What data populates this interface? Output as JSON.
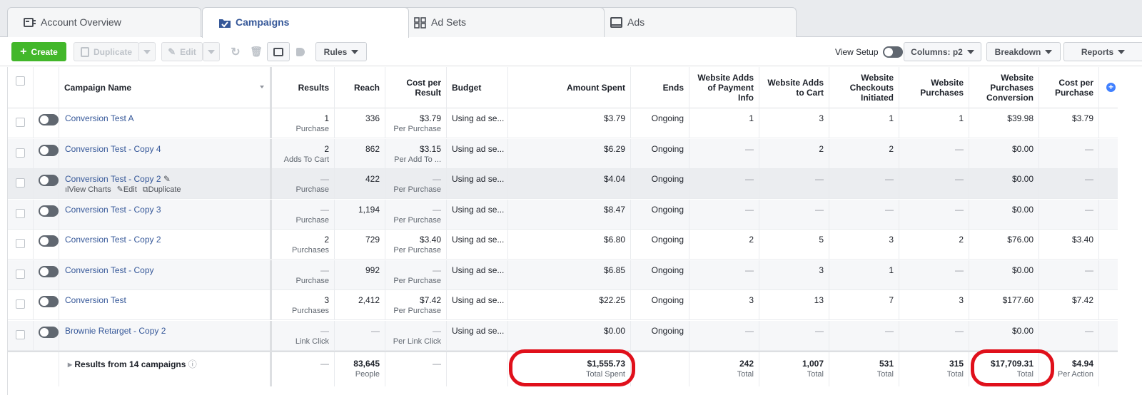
{
  "tabs": [
    {
      "label": "Account Overview",
      "icon": "account-overview-icon"
    },
    {
      "label": "Campaigns",
      "icon": "campaigns-folder-icon"
    },
    {
      "label": "Ad Sets",
      "icon": "ad-sets-grid-icon"
    },
    {
      "label": "Ads",
      "icon": "ads-icon"
    }
  ],
  "toolbar": {
    "create": "Create",
    "duplicate": "Duplicate",
    "edit": "Edit",
    "rules": "Rules",
    "view_setup": "View Setup",
    "columns": "Columns: p2",
    "breakdown": "Breakdown",
    "reports": "Reports"
  },
  "headers": {
    "campaign_name": "Campaign Name",
    "results": "Results",
    "reach": "Reach",
    "cost_per_result": "Cost per Result",
    "budget": "Budget",
    "amount_spent": "Amount Spent",
    "ends": "Ends",
    "adds_payment": "Website Adds of Payment Info",
    "adds_cart": "Website Adds to Cart",
    "checkouts": "Website Checkouts Initiated",
    "purchases": "Website Purchases",
    "purch_conv": "Website Purchases Conversion",
    "cost_per_purchase": "Cost per Purchase"
  },
  "hover_actions": {
    "view_charts": "View Charts",
    "edit": "Edit",
    "duplicate": "Duplicate"
  },
  "rows": [
    {
      "name": "Conversion Test A",
      "results": "1",
      "results_sub": "Purchase",
      "reach": "336",
      "cpr": "$3.79",
      "cpr_sub": "Per Purchase",
      "budget": "Using ad se...",
      "spent": "$3.79",
      "ends": "Ongoing",
      "payment": "1",
      "cart": "3",
      "checkout": "1",
      "purchases": "1",
      "conv": "$39.98",
      "cpp": "$3.79"
    },
    {
      "name": "Conversion Test - Copy 4",
      "results": "2",
      "results_sub": "Adds To Cart",
      "reach": "862",
      "cpr": "$3.15",
      "cpr_sub": "Per Add To ...",
      "budget": "Using ad se...",
      "spent": "$6.29",
      "ends": "Ongoing",
      "payment": "—",
      "cart": "2",
      "checkout": "2",
      "purchases": "—",
      "conv": "$0.00",
      "cpp": "—"
    },
    {
      "name": "Conversion Test - Copy 2",
      "results": "—",
      "results_sub": "Purchase",
      "reach": "422",
      "cpr": "—",
      "cpr_sub": "Per Purchase",
      "budget": "Using ad se...",
      "spent": "$4.04",
      "ends": "Ongoing",
      "payment": "—",
      "cart": "—",
      "checkout": "—",
      "purchases": "—",
      "conv": "$0.00",
      "cpp": "—"
    },
    {
      "name": "Conversion Test - Copy 3",
      "results": "—",
      "results_sub": "Purchase",
      "reach": "1,194",
      "cpr": "—",
      "cpr_sub": "Per Purchase",
      "budget": "Using ad se...",
      "spent": "$8.47",
      "ends": "Ongoing",
      "payment": "—",
      "cart": "—",
      "checkout": "—",
      "purchases": "—",
      "conv": "$0.00",
      "cpp": "—"
    },
    {
      "name": "Conversion Test - Copy 2",
      "results": "2",
      "results_sub": "Purchases",
      "reach": "729",
      "cpr": "$3.40",
      "cpr_sub": "Per Purchase",
      "budget": "Using ad se...",
      "spent": "$6.80",
      "ends": "Ongoing",
      "payment": "2",
      "cart": "5",
      "checkout": "3",
      "purchases": "2",
      "conv": "$76.00",
      "cpp": "$3.40"
    },
    {
      "name": "Conversion Test - Copy",
      "results": "—",
      "results_sub": "Purchase",
      "reach": "992",
      "cpr": "—",
      "cpr_sub": "Per Purchase",
      "budget": "Using ad se...",
      "spent": "$6.85",
      "ends": "Ongoing",
      "payment": "—",
      "cart": "3",
      "checkout": "1",
      "purchases": "—",
      "conv": "$0.00",
      "cpp": "—"
    },
    {
      "name": "Conversion Test",
      "results": "3",
      "results_sub": "Purchases",
      "reach": "2,412",
      "cpr": "$7.42",
      "cpr_sub": "Per Purchase",
      "budget": "Using ad se...",
      "spent": "$22.25",
      "ends": "Ongoing",
      "payment": "3",
      "cart": "13",
      "checkout": "7",
      "purchases": "3",
      "conv": "$177.60",
      "cpp": "$7.42"
    },
    {
      "name": "Brownie Retarget - Copy 2",
      "results": "—",
      "results_sub": "Link Click",
      "reach": "—",
      "cpr": "—",
      "cpr_sub": "Per Link Click",
      "budget": "Using ad se...",
      "spent": "$0.00",
      "ends": "Ongoing",
      "payment": "—",
      "cart": "—",
      "checkout": "—",
      "purchases": "—",
      "conv": "$0.00",
      "cpp": "—"
    }
  ],
  "totals": {
    "label": "Results from 14 campaigns",
    "results": "—",
    "reach": "83,645",
    "reach_sub": "People",
    "cpr": "—",
    "spent": "$1,555.73",
    "spent_sub": "Total Spent",
    "payment": "242",
    "payment_sub": "Total",
    "cart": "1,007",
    "cart_sub": "Total",
    "checkout": "531",
    "checkout_sub": "Total",
    "purchases": "315",
    "purchases_sub": "Total",
    "conv": "$17,709.31",
    "conv_sub": "Total",
    "cpp": "$4.94",
    "cpp_sub": "Per Action"
  },
  "colors": {
    "accent": "#365899",
    "create": "#42b72a",
    "highlight_ring": "#e0101b"
  }
}
